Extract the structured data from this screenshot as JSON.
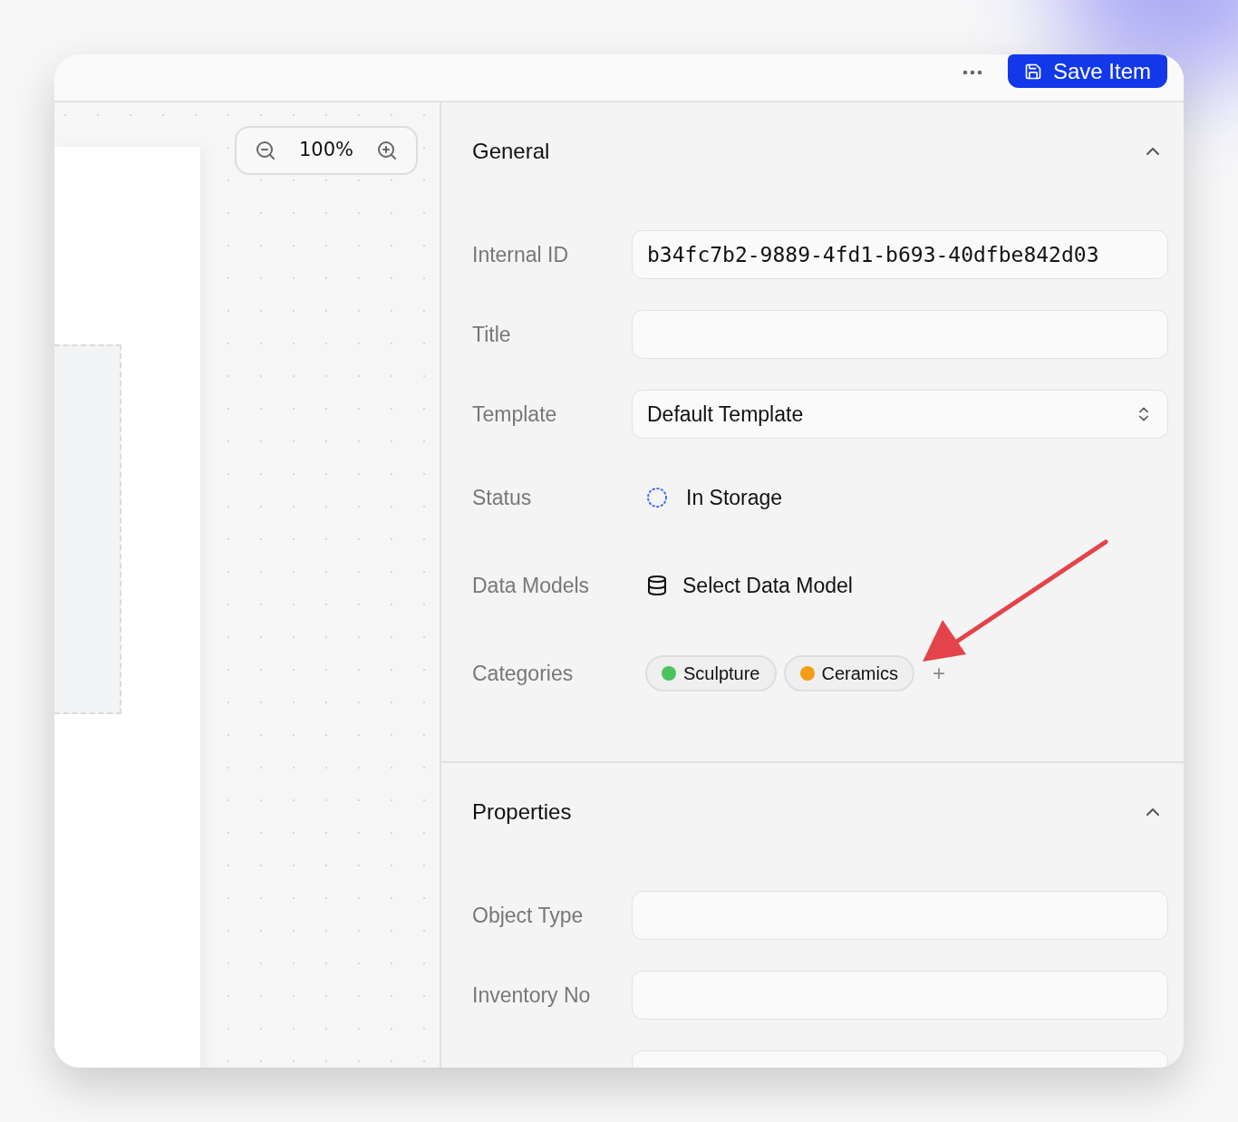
{
  "toolbar": {
    "save_button": "Save Item"
  },
  "canvas": {
    "zoom": "100%"
  },
  "sections": [
    {
      "title": "General",
      "expanded": true,
      "fields": [
        {
          "kind": "text",
          "label": "Internal ID",
          "value": "b34fc7b2-9889-4fd1-b693-40dfbe842d03"
        },
        {
          "kind": "text",
          "label": "Title"
        },
        {
          "kind": "select",
          "label": "Template",
          "value": "Default Template"
        },
        {
          "kind": "status",
          "label": "Status",
          "value": "In Storage"
        },
        {
          "kind": "data_model",
          "label": "Data Models",
          "value": "Select Data Model"
        },
        {
          "kind": "categories",
          "label": "Categories",
          "tags": [
            {
              "label": "Sculpture",
              "color": "#4cc35e"
            },
            {
              "label": "Ceramics",
              "color": "#f29d16"
            }
          ],
          "add": "+"
        }
      ]
    },
    {
      "title": "Properties",
      "expanded": true,
      "fields": [
        {
          "kind": "text",
          "label": "Object Type"
        },
        {
          "kind": "text",
          "label": "Inventory No"
        },
        {
          "kind": "text"
        }
      ]
    }
  ]
}
